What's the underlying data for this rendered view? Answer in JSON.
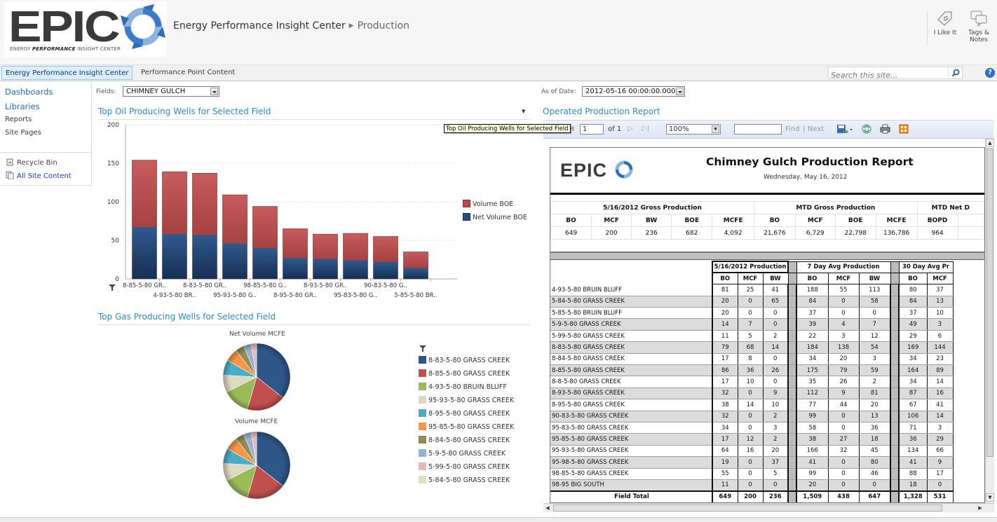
{
  "header": {
    "logo_text": "EPIC",
    "logo_tagline_pre": "ENERGY ",
    "logo_tagline_bold": "PERFORMANCE",
    "logo_tagline_post": " INSIGHT CENTER",
    "breadcrumb_site": "Energy Performance Insight Center",
    "breadcrumb_page": "Production",
    "like_label": "I Like It",
    "tags_label_1": "Tags &",
    "tags_label_2": "Notes"
  },
  "topnav": {
    "tabs": [
      {
        "label": "Energy Performance Insight Center",
        "selected": true
      },
      {
        "label": "Performance Point Content",
        "selected": false
      }
    ],
    "search_placeholder": "Search this site...",
    "help_label": "?"
  },
  "leftnav": {
    "items": [
      {
        "label": "Dashboards"
      },
      {
        "label": "Libraries"
      },
      {
        "label": "Reports"
      },
      {
        "label": "Site Pages"
      }
    ],
    "recycle_bin": "Recycle Bin",
    "all_site_content": "All Site Content"
  },
  "filters": {
    "fields_label": "Fields:",
    "fields_value": "CHIMNEY GULCH",
    "asof_label": "As of Date:",
    "asof_value": "2012-05-16 00:00:00.000"
  },
  "oil_panel": {
    "title": "Top Oil Producing Wells for Selected Field",
    "tooltip": "Top Oil Producing Wells for Selected Field"
  },
  "gas_panel": {
    "title": "Top Gas Producing Wells for Selected Field"
  },
  "chart_data": [
    {
      "type": "bar",
      "stacked": "overlay",
      "title": "Top Oil Producing Wells for Selected Field",
      "categories": [
        "8-85-5-80 GR..",
        "4-93-5-80 BR..",
        "8-83-5-80 GR..",
        "95-93-5-80 G..",
        "98-85-5-80 G..",
        "8-95-5-80 GR..",
        "8-93-5-80 GR..",
        "95-83-5-80 G..",
        "90-83-5-80 G..",
        "5-85-5-80 BR.."
      ],
      "series": [
        {
          "name": "Volume BOE",
          "color": "#b94a4a",
          "values": [
            154,
            139,
            137,
            109,
            94,
            65,
            58,
            59,
            55,
            35
          ]
        },
        {
          "name": "Net Volume BOE",
          "color": "#284e7e",
          "values": [
            67,
            58,
            57,
            46,
            40,
            27,
            26,
            24,
            22,
            14
          ]
        }
      ],
      "ylim": [
        0,
        200
      ],
      "yticks": [
        0,
        50,
        100,
        150,
        200
      ],
      "grid": true,
      "legend": "right"
    },
    {
      "type": "pie",
      "title": "Net Volume MCFE",
      "labels": [
        "8-83-5-80 GRASS CREEK",
        "8-85-5-80 GRASS CREEK",
        "4-93-5-80 BRUIN BLUFF",
        "95-93-5-80 GRASS CREEK",
        "8-95-5-80 GRASS CREEK",
        "95-85-5-80 GRASS CREEK",
        "8-84-5-80 GRASS CREEK",
        "5-9-5-80 GRASS CREEK",
        "5-99-5-80 GRASS CREEK",
        "5-84-5-80 GRASS CREEK"
      ],
      "values": [
        68,
        36,
        25,
        16,
        14,
        12,
        8,
        7,
        5,
        0
      ],
      "legend": "right"
    },
    {
      "type": "pie",
      "title": "Volume MCFE",
      "labels": [
        "8-83-5-80 GRASS CREEK",
        "8-85-5-80 GRASS CREEK",
        "4-93-5-80 BRUIN BLUFF",
        "95-93-5-80 GRASS CREEK",
        "8-95-5-80 GRASS CREEK",
        "95-85-5-80 GRASS CREEK",
        "8-84-5-80 GRASS CREEK",
        "5-9-5-80 GRASS CREEK",
        "5-99-5-80 GRASS CREEK",
        "5-84-5-80 GRASS CREEK"
      ],
      "values": [
        68,
        36,
        25,
        16,
        14,
        12,
        8,
        7,
        5,
        0
      ],
      "legend": "right"
    }
  ],
  "pie_colors": [
    "#2f5689",
    "#c0504d",
    "#9bbb59",
    "#ddd9c3",
    "#4bacc6",
    "#f79646",
    "#948a54",
    "#95b3d7",
    "#e6b9b8",
    "#d7e4bd"
  ],
  "report_panel": {
    "title": "Operated Production Report",
    "toolbar": {
      "page_value": "1",
      "of_label": "of 1",
      "zoom_value": "100%",
      "find_value": "",
      "find_label": "Find",
      "sep": "|",
      "next_label": "Next"
    },
    "report": {
      "logo": "EPIC",
      "title": "Chimney Gulch Production Report",
      "date": "Wednesday, May 16, 2012",
      "summary_groups": [
        "5/16/2012 Gross Production",
        "MTD Gross Production",
        "MTD Net D"
      ],
      "summary_headers": [
        "BO",
        "MCF",
        "BW",
        "BOE",
        "MCFE",
        "BO",
        "MCF",
        "BOE",
        "MCFE",
        "BOPD",
        ""
      ],
      "summary_values": [
        "649",
        "200",
        "236",
        "682",
        "4,092",
        "21,676",
        "6,729",
        "22,798",
        "136,786",
        "964",
        ""
      ],
      "detail_groups": [
        "5/16/2012 Production",
        "7 Day Avg Production",
        "30 Day Avg Pr"
      ],
      "detail_headers": [
        "BO",
        "MCF",
        "BW",
        "BO",
        "MCF",
        "BW",
        "BO",
        "MCF"
      ],
      "rows": [
        {
          "name": "4-93-5-80 BRUIN BLUFF",
          "v": [
            "81",
            "25",
            "41",
            "188",
            "55",
            "113",
            "80",
            "37"
          ]
        },
        {
          "name": "5-84-5-80 GRASS CREEK",
          "v": [
            "20",
            "0",
            "65",
            "84",
            "0",
            "58",
            "84",
            "13"
          ]
        },
        {
          "name": "5-85-5-80 BRUIN BLUFF",
          "v": [
            "20",
            "0",
            "0",
            "37",
            "0",
            "0",
            "37",
            "10"
          ]
        },
        {
          "name": "5-9-5-80 GRASS CREEK",
          "v": [
            "14",
            "7",
            "0",
            "39",
            "4",
            "7",
            "49",
            "3"
          ]
        },
        {
          "name": "5-99-5-80 GRASS CREEK",
          "v": [
            "11",
            "5",
            "2",
            "22",
            "3",
            "12",
            "29",
            "6"
          ]
        },
        {
          "name": "8-83-5-80 GRASS CREEK",
          "v": [
            "79",
            "68",
            "14",
            "184",
            "138",
            "54",
            "169",
            "144"
          ]
        },
        {
          "name": "8-84-5-80 GRASS CREEK",
          "v": [
            "17",
            "8",
            "0",
            "34",
            "20",
            "3",
            "34",
            "23"
          ]
        },
        {
          "name": "8-85-5-80 GRASS CREEK",
          "v": [
            "86",
            "36",
            "26",
            "175",
            "79",
            "59",
            "164",
            "89"
          ]
        },
        {
          "name": "8-8-5-80 GRASS CREEK",
          "v": [
            "17",
            "10",
            "0",
            "35",
            "26",
            "2",
            "34",
            "14"
          ]
        },
        {
          "name": "8-93-5-80 GRASS CREEK",
          "v": [
            "32",
            "0",
            "9",
            "112",
            "9",
            "81",
            "87",
            "16"
          ]
        },
        {
          "name": "8-95-5-80 GRASS CREEK",
          "v": [
            "38",
            "14",
            "10",
            "77",
            "44",
            "20",
            "67",
            "41"
          ]
        },
        {
          "name": "90-83-5-80 GRASS CREEK",
          "v": [
            "32",
            "0",
            "2",
            "99",
            "0",
            "13",
            "106",
            "14"
          ]
        },
        {
          "name": "95-83-5-80 GRASS CREEK",
          "v": [
            "34",
            "0",
            "3",
            "58",
            "0",
            "36",
            "71",
            "3"
          ]
        },
        {
          "name": "95-85-5-80 GRASS CREEK",
          "v": [
            "17",
            "12",
            "2",
            "38",
            "27",
            "18",
            "36",
            "29"
          ]
        },
        {
          "name": "95-93-5-80 GRASS CREEK",
          "v": [
            "64",
            "16",
            "20",
            "166",
            "32",
            "45",
            "134",
            "66"
          ]
        },
        {
          "name": "95-98-5-80 GRASS CREEK",
          "v": [
            "19",
            "0",
            "37",
            "41",
            "0",
            "80",
            "41",
            "9"
          ]
        },
        {
          "name": "98-85-5-80 GRASS CREEK",
          "v": [
            "55",
            "0",
            "5",
            "99",
            "0",
            "46",
            "88",
            "17"
          ]
        },
        {
          "name": "98-95 BIG SOUTH",
          "v": [
            "11",
            "0",
            "0",
            "20",
            "0",
            "0",
            "18",
            "0"
          ]
        }
      ],
      "total": {
        "name": "Field Total",
        "v": [
          "649",
          "200",
          "236",
          "1,509",
          "438",
          "647",
          "1,328",
          "531"
        ]
      }
    }
  }
}
